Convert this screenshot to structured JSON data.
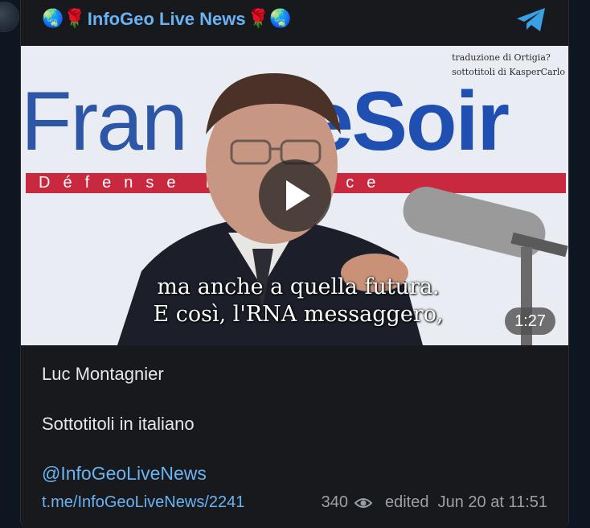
{
  "channel": {
    "name": "InfoGeo Live News",
    "emoji_left": "🌏🌹",
    "emoji_right": "🌹🌏"
  },
  "icons": {
    "telegram": "telegram-plane-icon",
    "play": "play-icon",
    "views": "eye-icon"
  },
  "colors": {
    "link": "#6ab3f3",
    "card": "#18191d",
    "background": "#0e1621"
  },
  "video": {
    "logo_part1": "Fran",
    "logo_part2": "eSoir",
    "banner": "Défense  la  France",
    "credit_line1": "traduzione di Ortigia?",
    "credit_line2": "sottotitoli di KasperCarlo",
    "subtitle_line1": "ma anche a quella futura.",
    "subtitle_line2": "E così, l'RNA messaggero,",
    "duration": "1:27"
  },
  "post": {
    "line1": "Luc Montagnier",
    "line2": "Sottotitoli in italiano",
    "mention": "@InfoGeoLiveNews",
    "link": "t.me/InfoGeoLiveNews/2241",
    "views": "340",
    "edited": "edited  Jun 20 at 11:51"
  }
}
